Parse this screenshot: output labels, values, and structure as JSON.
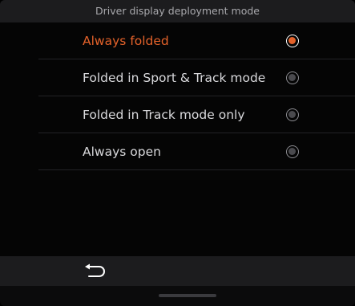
{
  "header": {
    "title": "Driver display deployment mode"
  },
  "options": [
    {
      "label": "Always folded",
      "selected": true
    },
    {
      "label": "Folded in Sport & Track mode",
      "selected": false
    },
    {
      "label": "Folded in Track mode only",
      "selected": false
    },
    {
      "label": "Always open",
      "selected": false
    }
  ],
  "bottom_bar": {
    "back_icon": "back-arrow-icon"
  },
  "colors": {
    "accent": "#e4622a",
    "background": "#050505",
    "bar": "#1c1c1e",
    "text": "#d9d9dc",
    "header_text": "#a9a9ad"
  }
}
